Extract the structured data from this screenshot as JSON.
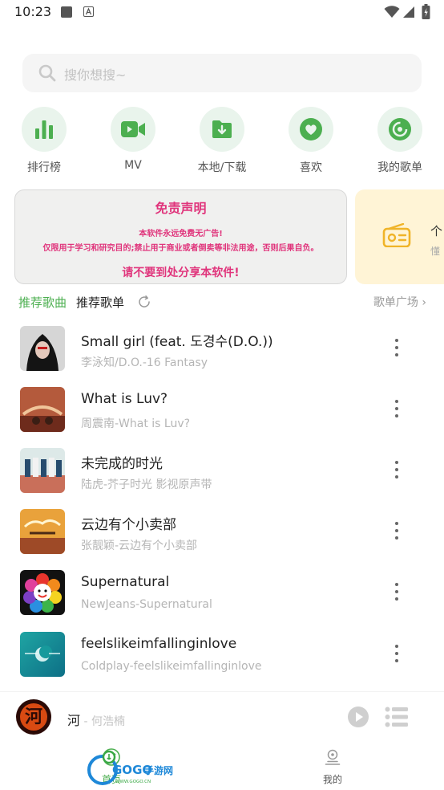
{
  "status_bar": {
    "time": "10:23"
  },
  "search": {
    "placeholder": "搜你想搜~"
  },
  "shortcuts": [
    {
      "label": "排行榜",
      "icon": "bar-chart-icon"
    },
    {
      "label": "MV",
      "icon": "video-camera-icon"
    },
    {
      "label": "本地/下载",
      "icon": "download-folder-icon"
    },
    {
      "label": "喜欢",
      "icon": "heart-icon"
    },
    {
      "label": "我的歌单",
      "icon": "disc-icon"
    }
  ],
  "banner": {
    "title": "免责声明",
    "line1": "本软件永远免费无广告!",
    "line2": "仅限用于学习和研究目的;禁止用于商业或者倒卖等非法用途，否则后果自负。",
    "line3": "请不要到处分享本软件!"
  },
  "banner2": {
    "title": "个",
    "subtitle": "懂"
  },
  "tabs": {
    "recommend_songs": "推荐歌曲",
    "recommend_playlists": "推荐歌单"
  },
  "playlist_square": "歌单广场 ›",
  "songs": [
    {
      "title": "Small girl (feat. 도경수(D.O.))",
      "subtitle": "李泳知/D.O.-16 Fantasy"
    },
    {
      "title": "What is Luv?",
      "subtitle": "周震南-What is Luv?"
    },
    {
      "title": "未完成的时光",
      "subtitle": "陆虎-芥子时光 影视原声带"
    },
    {
      "title": "云边有个小卖部",
      "subtitle": "张靓颖-云边有个小卖部"
    },
    {
      "title": "Supernatural",
      "subtitle": "NewJeans-Supernatural"
    },
    {
      "title": "feelslikeimfallinginlove",
      "subtitle": "Coldplay-feelslikeimfallinginlove"
    }
  ],
  "player": {
    "title": "河",
    "artist": " - 何浩楠",
    "disc_char": "河"
  },
  "bottom_nav": {
    "home": "首页",
    "mine": "我的"
  },
  "watermark": {
    "brand": "GOGO手游网",
    "url": "WWW.GOGO.CN"
  },
  "colors": {
    "accent": "#4caf50",
    "banner_text": "#e0357c",
    "icon_bg": "#e9f4ec"
  }
}
